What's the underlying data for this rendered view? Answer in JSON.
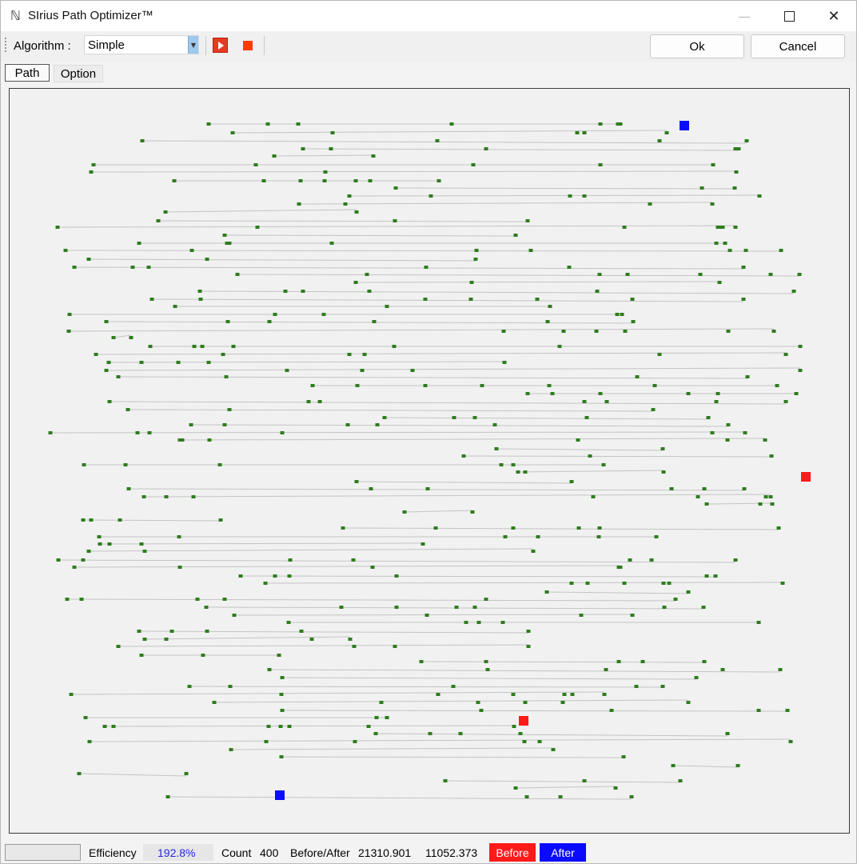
{
  "window": {
    "title": "SIrius Path Optimizer™",
    "icon": "path-app-icon"
  },
  "titlebar_controls": {
    "minimize": "—",
    "close": "✕"
  },
  "toolbar": {
    "algorithm_label": "Algorithm :",
    "algorithm_value": "Simple",
    "ok_label": "Ok",
    "cancel_label": "Cancel"
  },
  "tabs": [
    {
      "label": "Path",
      "active": true
    },
    {
      "label": "Option",
      "active": false
    }
  ],
  "canvas": {
    "point_color": "#2e7d1e",
    "line_color": "#c4c4c4",
    "before_marker_color": "#ff1a1a",
    "after_marker_color": "#0a0aff"
  },
  "status": {
    "efficiency_label": "Efficiency",
    "efficiency_value": "192.8%",
    "count_label": "Count",
    "count_value": "400",
    "before_after_label": "Before/After",
    "before_value": "21310.901",
    "after_value": "11052.373",
    "before_badge": "Before",
    "after_badge": "After"
  }
}
